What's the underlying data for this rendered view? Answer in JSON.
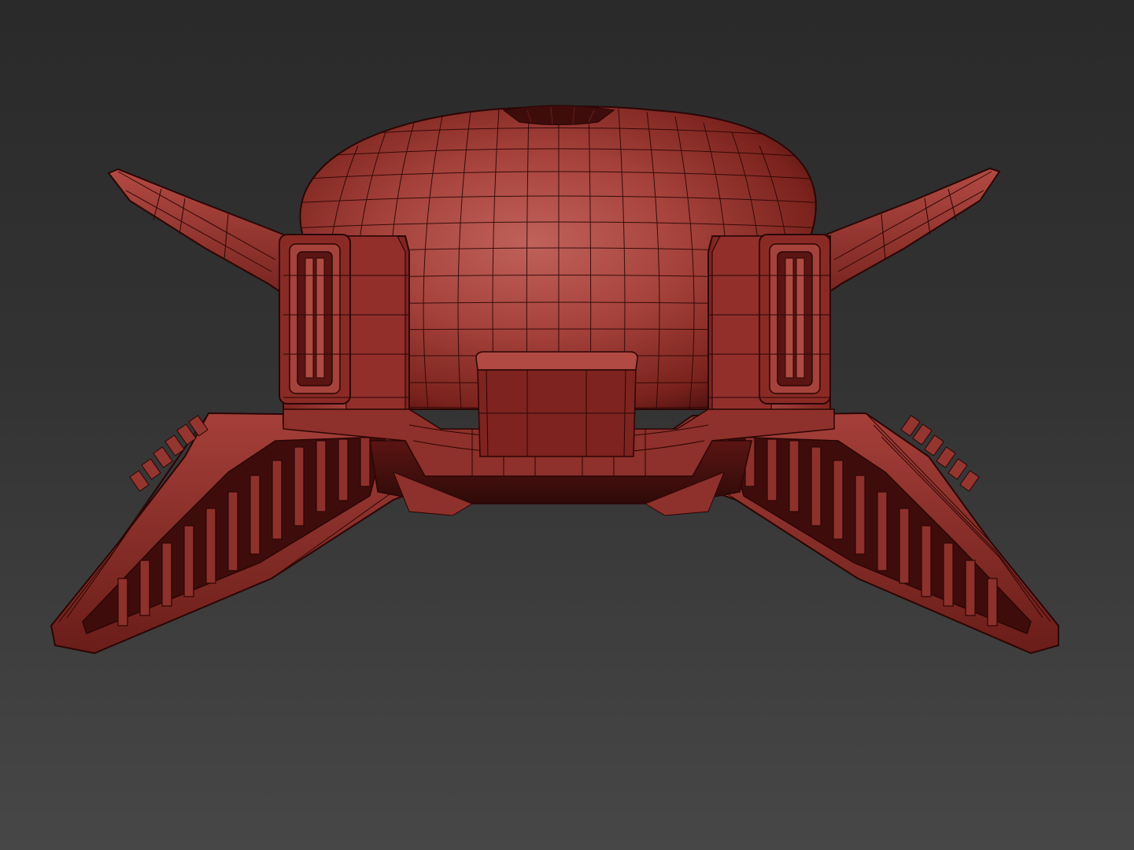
{
  "scene": {
    "background_top": "#2a2a2a",
    "background_bottom": "#474747",
    "model_base_color": "#a8403a",
    "model_shadow_color": "#5a1512",
    "model_highlight_color": "#c25a52",
    "wire_color": "#2a0605",
    "icon": "helmet-wireframe-model"
  }
}
